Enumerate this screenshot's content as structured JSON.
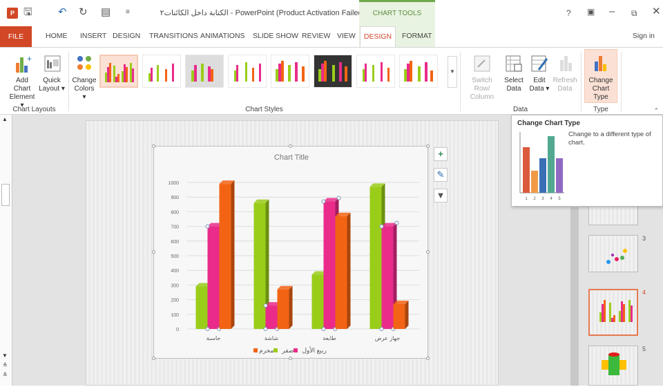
{
  "window": {
    "title": "الكتابة داخل الكائنات٢ - PowerPoint (Product Activation Failed)",
    "context_group": "CHART TOOLS",
    "help": "?",
    "signin": "Sign in"
  },
  "tabs": [
    "FILE",
    "HOME",
    "INSERT",
    "DESIGN",
    "TRANSITIONS",
    "ANIMATIONS",
    "SLIDE SHOW",
    "REVIEW",
    "VIEW",
    "DESIGN",
    "FORMAT"
  ],
  "active_tab": "DESIGN",
  "ribbon": {
    "add_chart_element": [
      "Add Chart",
      "Element ▾"
    ],
    "quick_layout": [
      "Quick",
      "Layout ▾"
    ],
    "change_colors": [
      "Change",
      "Colors ▾"
    ],
    "switch_row_col": [
      "Switch Row/",
      "Column"
    ],
    "select_data": [
      "Select",
      "Data"
    ],
    "edit_data": [
      "Edit",
      "Data ▾"
    ],
    "refresh_data": [
      "Refresh",
      "Data"
    ],
    "change_chart_type": [
      "Change",
      "Chart Type"
    ],
    "groups": {
      "layouts": "Chart Layouts",
      "styles": "Chart Styles",
      "data": "Data",
      "type": "Type"
    }
  },
  "tooltip": {
    "title": "Change Chart Type",
    "description": "Change to a different type of chart.",
    "preview_ticks": [
      "1",
      "2",
      "3",
      "4",
      "5"
    ]
  },
  "chart_data": {
    "type": "bar",
    "title": "Chart Title",
    "categories": [
      "حاسبة",
      "شاشة",
      "طابعة",
      "جهاز عرض"
    ],
    "series": [
      {
        "name": "محرم",
        "color": "#9acd1a",
        "values": [
          290,
          860,
          370,
          970
        ]
      },
      {
        "name": "صفر",
        "color": "#ea2b8a",
        "values": [
          700,
          160,
          870,
          700
        ]
      },
      {
        "name": "ربيع الأول",
        "color": "#f26414",
        "values": [
          990,
          270,
          770,
          170
        ]
      }
    ],
    "yticks": [
      "0",
      "100",
      "200",
      "300",
      "400",
      "500",
      "600",
      "700",
      "800",
      "900",
      "1000"
    ],
    "ylim": [
      0,
      1000
    ],
    "legend_position": "bottom"
  },
  "slides_panel": {
    "numbers": [
      "3",
      "4",
      "5"
    ]
  }
}
